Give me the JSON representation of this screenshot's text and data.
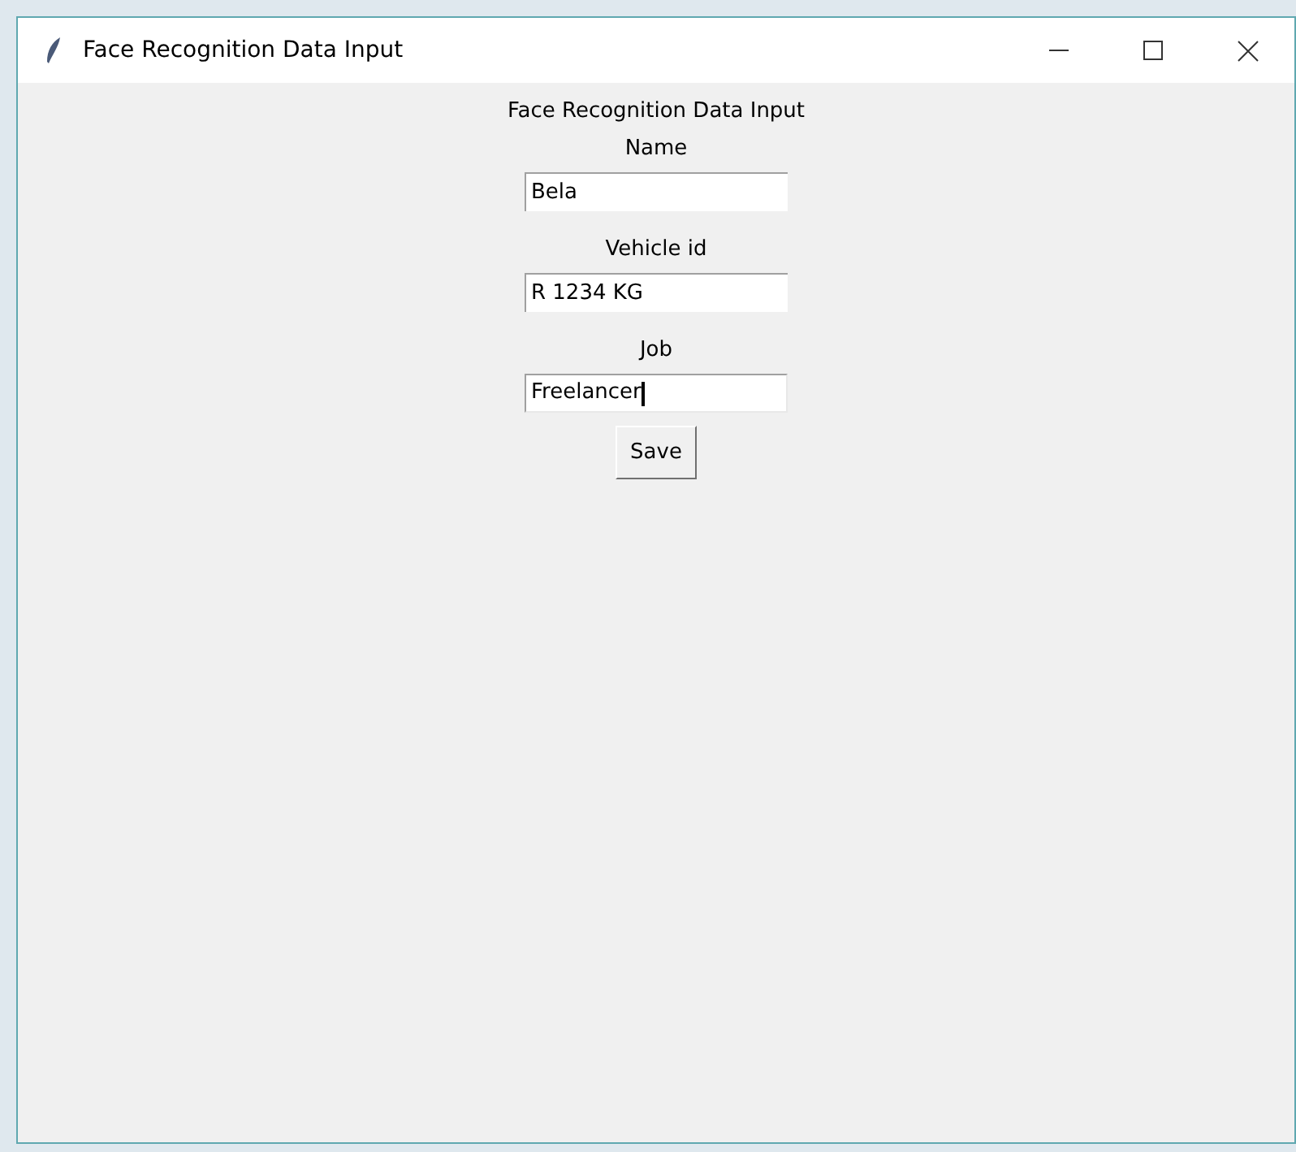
{
  "window": {
    "title": "Face Recognition Data Input"
  },
  "heading": "Face Recognition Data Input",
  "fields": [
    {
      "label": "Name",
      "value": "Bela",
      "focused": false
    },
    {
      "label": "Vehicle id",
      "value": "R 1234 KG",
      "focused": false
    },
    {
      "label": "Job",
      "value": "Freelancer",
      "focused": true
    }
  ],
  "buttons": [
    "Save"
  ]
}
